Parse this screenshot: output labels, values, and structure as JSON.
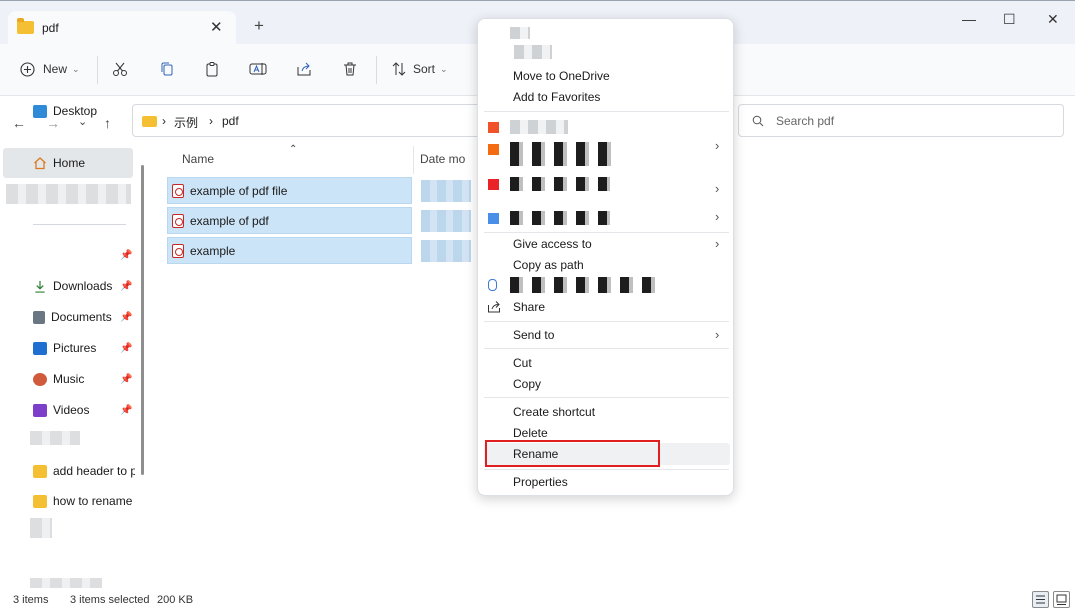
{
  "window": {
    "tab_title": "pdf",
    "tab_close": "✕",
    "new_tab": "+",
    "minimize": "—",
    "maximize": "☐",
    "close": "✕"
  },
  "toolbar": {
    "new_label": "New",
    "sort_label": "Sort"
  },
  "address": {
    "crumb1": "示例",
    "crumb2": "pdf",
    "sep": "›",
    "search_placeholder": "Search pdf"
  },
  "sidebar": {
    "home": "Home",
    "items": [
      {
        "label": "Desktop",
        "icon": "desktop-icon",
        "color": "#2f8ad8"
      },
      {
        "label": "Downloads",
        "icon": "download-icon",
        "color": "#2e7d32"
      },
      {
        "label": "Documents",
        "icon": "document-icon",
        "color": "#6b7683"
      },
      {
        "label": "Pictures",
        "icon": "pictures-icon",
        "color": "#1e6fd0"
      },
      {
        "label": "Music",
        "icon": "music-icon",
        "color": "#d05a3c"
      },
      {
        "label": "Videos",
        "icon": "videos-icon",
        "color": "#7b3fc9"
      },
      {
        "label": "add header to p",
        "icon": "folder-icon",
        "color": "#f4bf32"
      },
      {
        "label": "how to rename",
        "icon": "folder-icon",
        "color": "#f4bf32"
      }
    ]
  },
  "columns": {
    "name": "Name",
    "date": "Date mo"
  },
  "files": [
    {
      "name": "example of pdf file"
    },
    {
      "name": "example of pdf"
    },
    {
      "name": "example"
    }
  ],
  "context_menu": {
    "move_onedrive": "Move to OneDrive",
    "add_favorites": "Add to Favorites",
    "give_access": "Give access to",
    "copy_path": "Copy as path",
    "share": "Share",
    "send_to": "Send to",
    "cut": "Cut",
    "copy": "Copy",
    "create_shortcut": "Create shortcut",
    "delete": "Delete",
    "rename": "Rename",
    "properties": "Properties",
    "chevron": "›",
    "accent_colors": [
      "#f0522a",
      "#f36c12",
      "#ea2329",
      "#4a8fe7"
    ]
  },
  "status": {
    "count": "3 items",
    "selected": "3 items selected",
    "size": "200 KB"
  }
}
